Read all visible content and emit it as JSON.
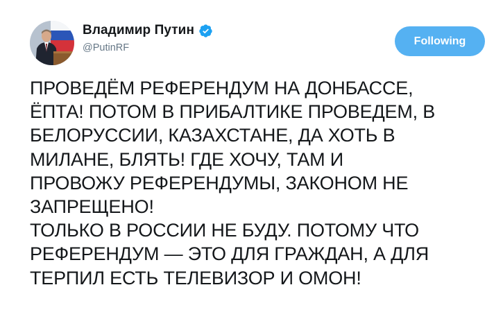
{
  "tweet": {
    "author": {
      "display_name": "Владимир Путин",
      "handle": "@PutinRF",
      "verified": true,
      "avatar_icon": "user-photo-avatar",
      "verified_icon": "verified-badge-icon",
      "verified_color": "#1da1f2"
    },
    "follow_button": {
      "label": "Following",
      "background": "#55b1f2"
    },
    "text_lines": [
      "ПРОВЕДЁМ РЕФЕРЕНДУМ НА ДОНБАССЕ,",
      "ЁПТА! ПОТОМ В ПРИБАЛТИКЕ ПРОВЕДЕМ, В",
      "БЕЛОРУССИИ, КАЗАХСТАНЕ, ДА ХОТЬ В",
      "МИЛАНЕ, БЛЯТЬ! ГДЕ ХОЧУ, ТАМ И",
      "ПРОВОЖУ РЕФЕРЕНДУМЫ, ЗАКОНОМ НЕ",
      "ЗАПРЕЩЕНО!",
      "ТОЛЬКО В РОССИИ НЕ БУДУ. ПОТОМУ ЧТО",
      "РЕФЕРЕНДУМ — ЭТО ДЛЯ ГРАЖДАН, А ДЛЯ",
      "ТЕРПИЛ ЕСТЬ ТЕЛЕВИЗОР И ОМОН!"
    ]
  }
}
